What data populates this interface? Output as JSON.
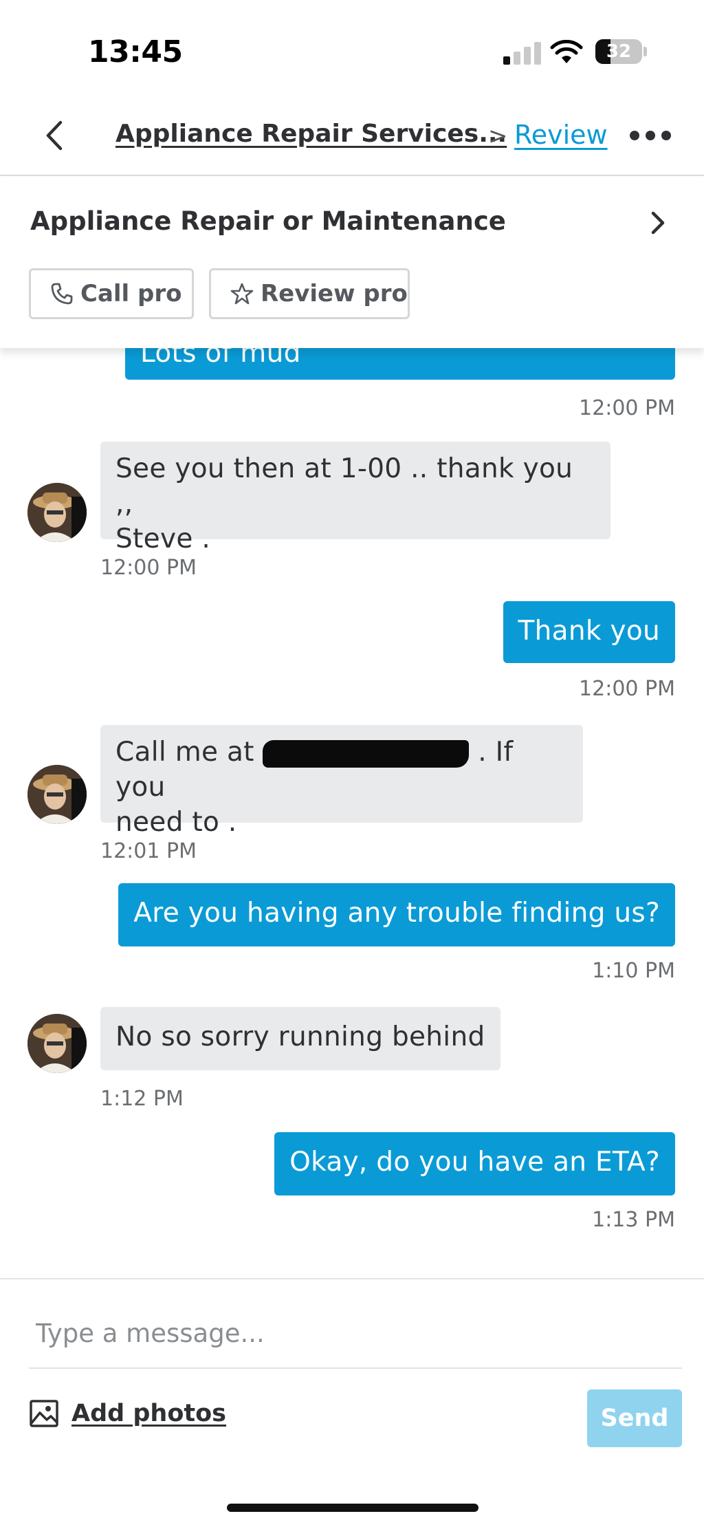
{
  "status_bar": {
    "time": "13:45",
    "battery": "32",
    "battery_level": 0.32
  },
  "nav": {
    "title": "Appliance Repair Services...",
    "separator": ">",
    "review_link": "Review"
  },
  "service": {
    "title": "Appliance Repair or Maintenance",
    "call_label": "Call pro",
    "review_label": "Review pro"
  },
  "messages": [
    {
      "direction": "outgoing",
      "text": "Lots of mud",
      "time": "12:00 PM"
    },
    {
      "direction": "incoming",
      "text_line1": "See you then at 1-00 .. thank you ,,",
      "text_line2": "Steve .",
      "time": "12:00 PM"
    },
    {
      "direction": "outgoing",
      "text": "Thank you",
      "time": "12:00 PM"
    },
    {
      "direction": "incoming",
      "text_before": "Call me at",
      "text_after": ".  If you",
      "text_line2": "need to .",
      "time": "12:01 PM"
    },
    {
      "direction": "outgoing",
      "text": "Are you having any trouble finding us?",
      "time": "1:10 PM"
    },
    {
      "direction": "incoming",
      "text": "No so sorry running behind",
      "time": "1:12 PM"
    },
    {
      "direction": "outgoing",
      "text": "Okay,  do you have an ETA?",
      "time": "1:13 PM"
    }
  ],
  "composer": {
    "placeholder": "Type a message...",
    "add_photos": "Add photos",
    "send": "Send"
  },
  "colors": {
    "accent": "#0a9bd6",
    "incoming_bubble": "#e8eaec",
    "send_disabled": "#8fd3ef"
  }
}
